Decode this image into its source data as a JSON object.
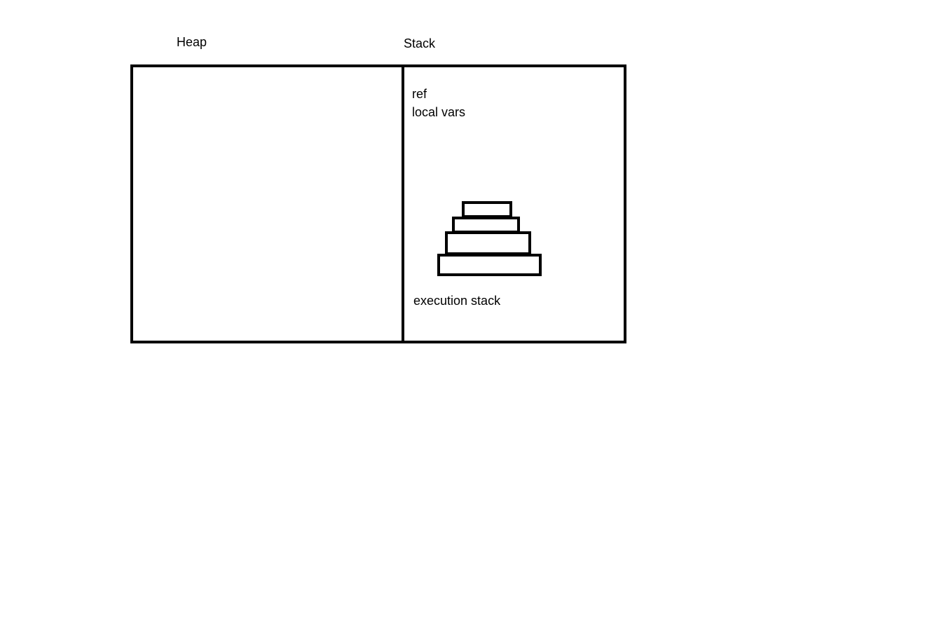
{
  "heap": {
    "title": "Heap"
  },
  "stack": {
    "title": "Stack",
    "ref_label": "ref",
    "local_vars_label": "local vars",
    "execution_stack_label": "execution stack"
  }
}
